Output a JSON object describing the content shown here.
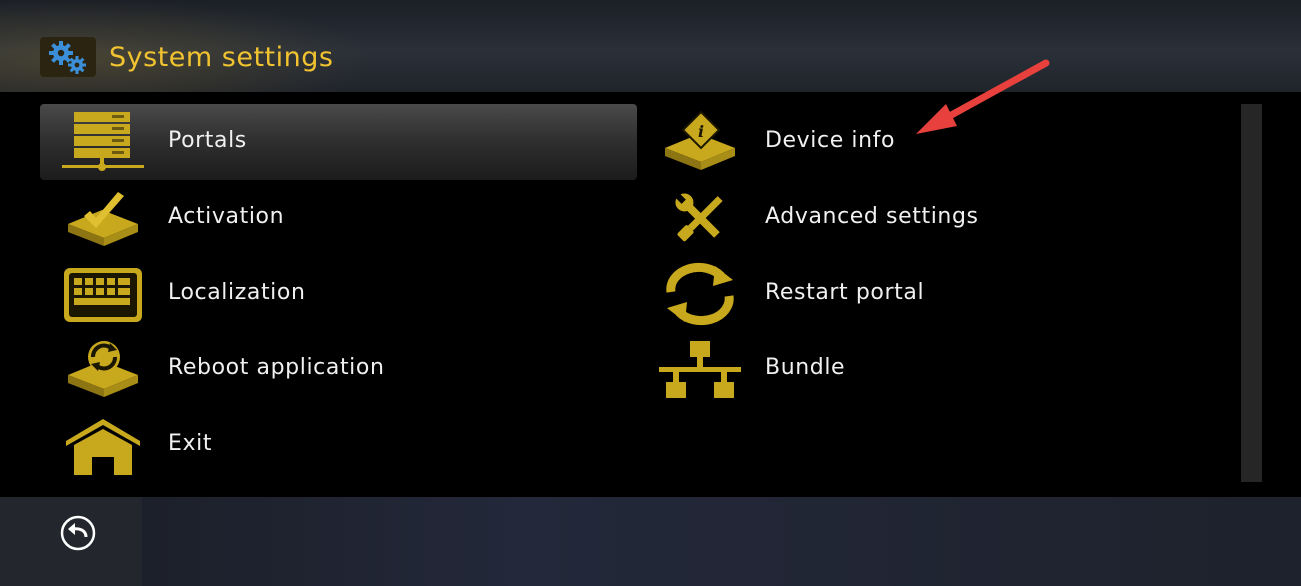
{
  "header": {
    "title": "System settings",
    "icon": "gears-icon"
  },
  "menu": {
    "left": [
      {
        "label": "Portals",
        "icon": "server-icon",
        "selected": true
      },
      {
        "label": "Activation",
        "icon": "activation-icon"
      },
      {
        "label": "Localization",
        "icon": "keyboard-icon"
      },
      {
        "label": "Reboot application",
        "icon": "reboot-icon"
      },
      {
        "label": "Exit",
        "icon": "house-icon"
      }
    ],
    "right": [
      {
        "label": "Device info",
        "icon": "device-info-icon"
      },
      {
        "label": "Advanced settings",
        "icon": "wrench-screwdriver-icon"
      },
      {
        "label": "Restart portal",
        "icon": "restart-arrows-icon"
      },
      {
        "label": "Bundle",
        "icon": "network-bundle-icon"
      }
    ]
  },
  "footer": {
    "back_icon": "back-arrow-icon"
  },
  "colors": {
    "accent": "#f2c330",
    "icon_gold": "#c8a91e",
    "annotation": "#e8413d"
  }
}
